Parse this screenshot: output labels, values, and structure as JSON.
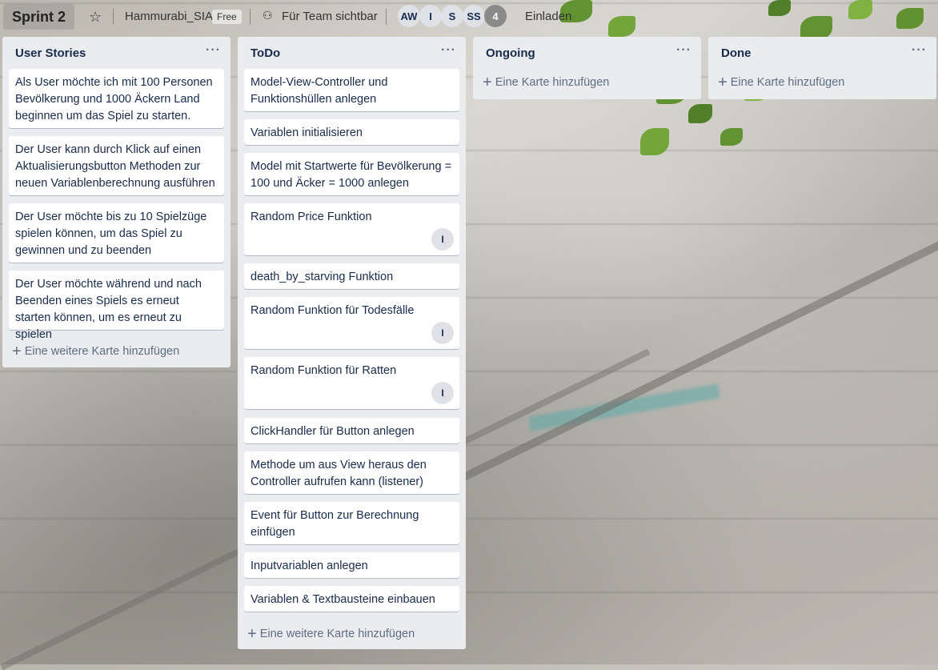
{
  "header": {
    "board_title": "Sprint 2",
    "team": "Hammurabi_SIA",
    "plan_badge": "Free",
    "visibility": "Für Team sichtbar",
    "members": [
      "AW",
      "I",
      "S",
      "SS"
    ],
    "member_overflow": "4",
    "invite": "Einladen"
  },
  "lists": [
    {
      "title": "User Stories",
      "menu": "···",
      "cards": [
        {
          "text": "Als User möchte ich mit 100 Personen Bevölkerung und 1000 Äckern Land beginnen um das Spiel zu starten."
        },
        {
          "text": "Der User kann durch Klick auf einen Aktualisierungsbutton Methoden zur neuen Variablenberechnung ausführen"
        },
        {
          "text": "Der User möchte bis zu 10 Spielzüge spielen können, um das Spiel zu gewinnen und zu beenden"
        },
        {
          "text": "Der User möchte während und nach Beenden eines Spiels es erneut starten können, um es erneut zu spielen"
        }
      ],
      "add_label": "Eine weitere Karte hinzufügen"
    },
    {
      "title": "ToDo",
      "menu": "···",
      "cards": [
        {
          "text": "Model-View-Controller und Funktionshüllen anlegen"
        },
        {
          "text": "Variablen initialisieren"
        },
        {
          "text": "Model mit Startwerte für Bevölkerung = 100 und Äcker = 1000 anlegen"
        },
        {
          "text": "Random Price Funktion",
          "member": "I"
        },
        {
          "text": "death_by_starving Funktion"
        },
        {
          "text": "Random Funktion für Todesfälle",
          "member": "I"
        },
        {
          "text": "Random Funktion für Ratten",
          "member": "I"
        },
        {
          "text": "ClickHandler für Button anlegen"
        },
        {
          "text": "Methode um aus View heraus den Controller aufrufen kann (listener)"
        },
        {
          "text": "Event für Button zur Berechnung einfügen"
        },
        {
          "text": "Inputvariablen anlegen"
        },
        {
          "text": "Variablen & Textbausteine einbauen"
        }
      ],
      "add_label": "Eine weitere Karte hinzufügen"
    },
    {
      "title": "Ongoing",
      "menu": "···",
      "cards": [],
      "add_label": "Eine Karte hinzufügen"
    },
    {
      "title": "Done",
      "menu": "···",
      "cards": [],
      "add_label": "Eine Karte hinzufügen"
    }
  ],
  "icons": {
    "star": "star-icon",
    "visibility": "team-visibility-icon",
    "plus": "plus-icon",
    "menu": "more-horizontal-icon"
  }
}
